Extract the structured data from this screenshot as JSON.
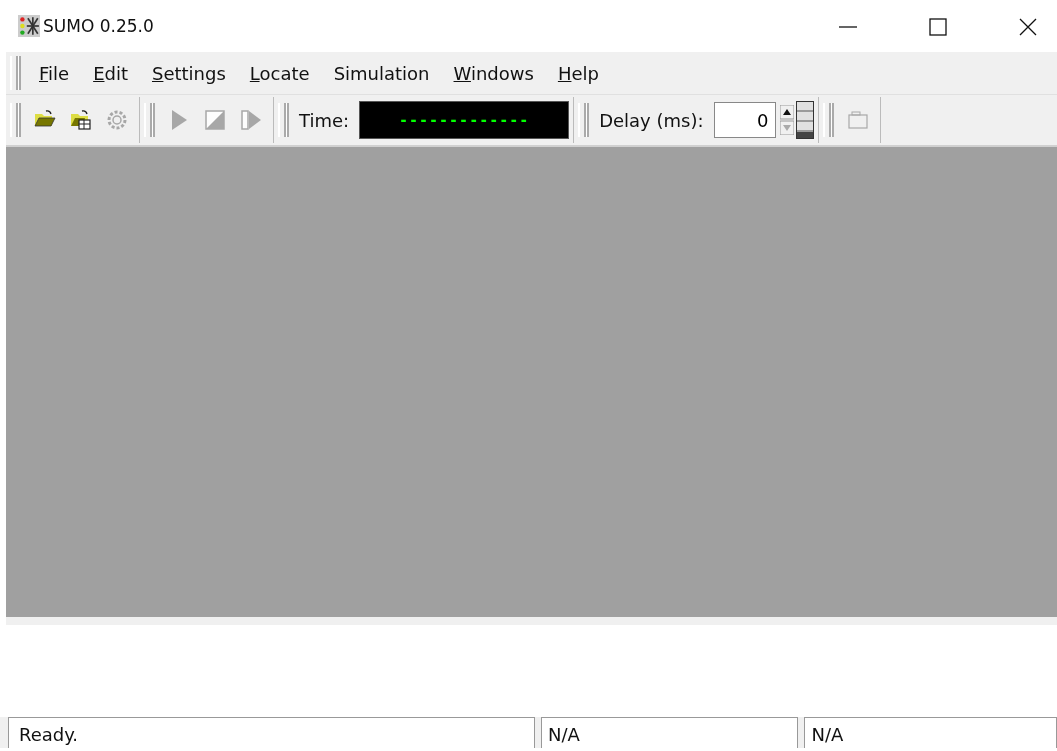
{
  "window": {
    "title": "SUMO 0.25.0"
  },
  "menu": [
    {
      "label": "File"
    },
    {
      "label": "Edit"
    },
    {
      "label": "Settings"
    },
    {
      "label": "Locate"
    },
    {
      "label": "Simulation",
      "plain": true
    },
    {
      "label": "Windows"
    },
    {
      "label": "Help"
    }
  ],
  "toolbar": {
    "file_tools": [
      {
        "kind": "open",
        "disabled": false
      },
      {
        "kind": "open-network",
        "disabled": false
      },
      {
        "kind": "reload",
        "disabled": true
      }
    ],
    "sim_tools": [
      {
        "kind": "play",
        "disabled": true
      },
      {
        "kind": "stop",
        "disabled": true
      },
      {
        "kind": "step",
        "disabled": true
      }
    ],
    "time_label": "Time:",
    "time_display": "-------------",
    "delay_label": "Delay (ms):",
    "delay_value": "0",
    "extra_tools": [
      {
        "kind": "view",
        "disabled": true
      }
    ]
  },
  "status_bar": [
    "Ready.",
    "N/A",
    "N/A"
  ]
}
